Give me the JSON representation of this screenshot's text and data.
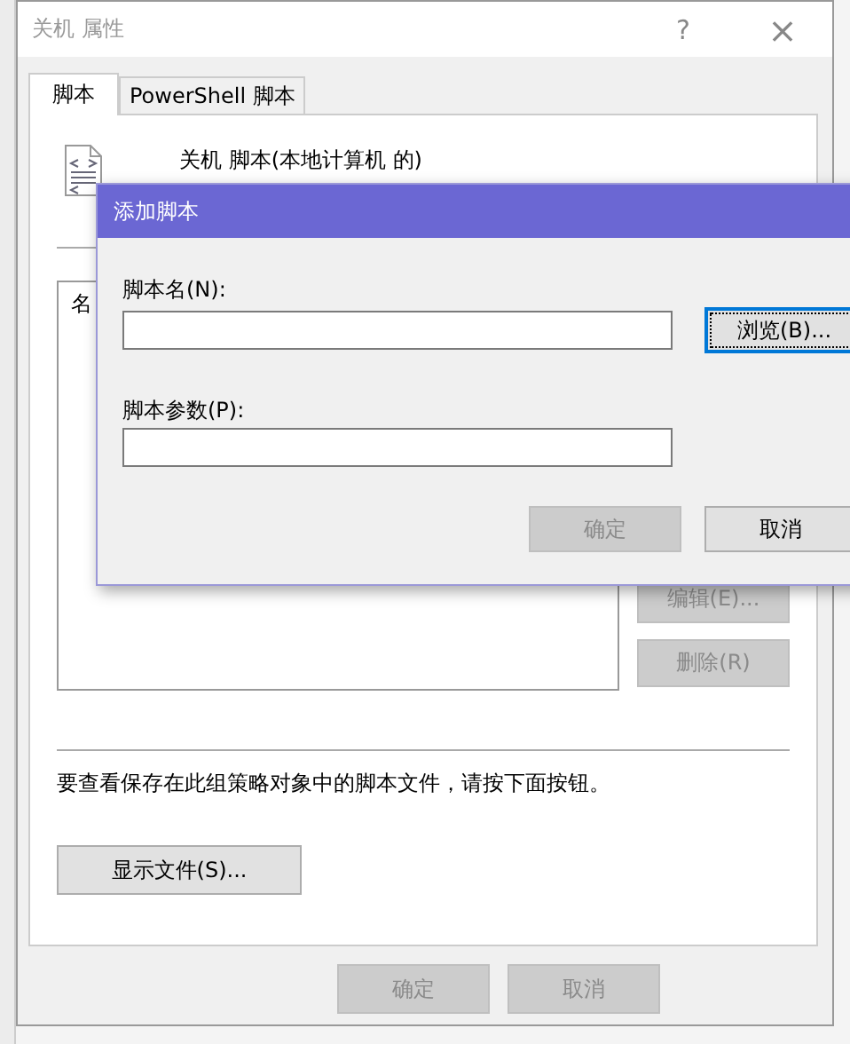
{
  "main_dialog": {
    "title": "关机 属性",
    "help": "?",
    "close": "×",
    "tabs": [
      {
        "label": "脚本",
        "selected": true
      },
      {
        "label": "PowerShell 脚本",
        "selected": false
      }
    ],
    "heading": "关机 脚本(本地计算机 的)",
    "list": {
      "column_1": "名"
    },
    "side_buttons": [
      {
        "label": "编辑(E)...",
        "disabled": true
      },
      {
        "label": "删除(R)",
        "disabled": true
      }
    ],
    "hint": "要查看保存在此组策略对象中的脚本文件，请按下面按钮。",
    "show_files_button": "显示文件(S)...",
    "footer_buttons": [
      {
        "label": "确定",
        "disabled": true
      },
      {
        "label": "取消",
        "disabled": true
      }
    ]
  },
  "add_script_dialog": {
    "title": "添加脚本",
    "fields": [
      {
        "label": "脚本名(N):",
        "button": {
          "label": "浏览(B)...",
          "focused": true
        }
      },
      {
        "label": "脚本参数(P):"
      }
    ],
    "buttons": [
      {
        "label": "确定",
        "disabled": true
      },
      {
        "label": "取消",
        "disabled": false
      }
    ]
  }
}
